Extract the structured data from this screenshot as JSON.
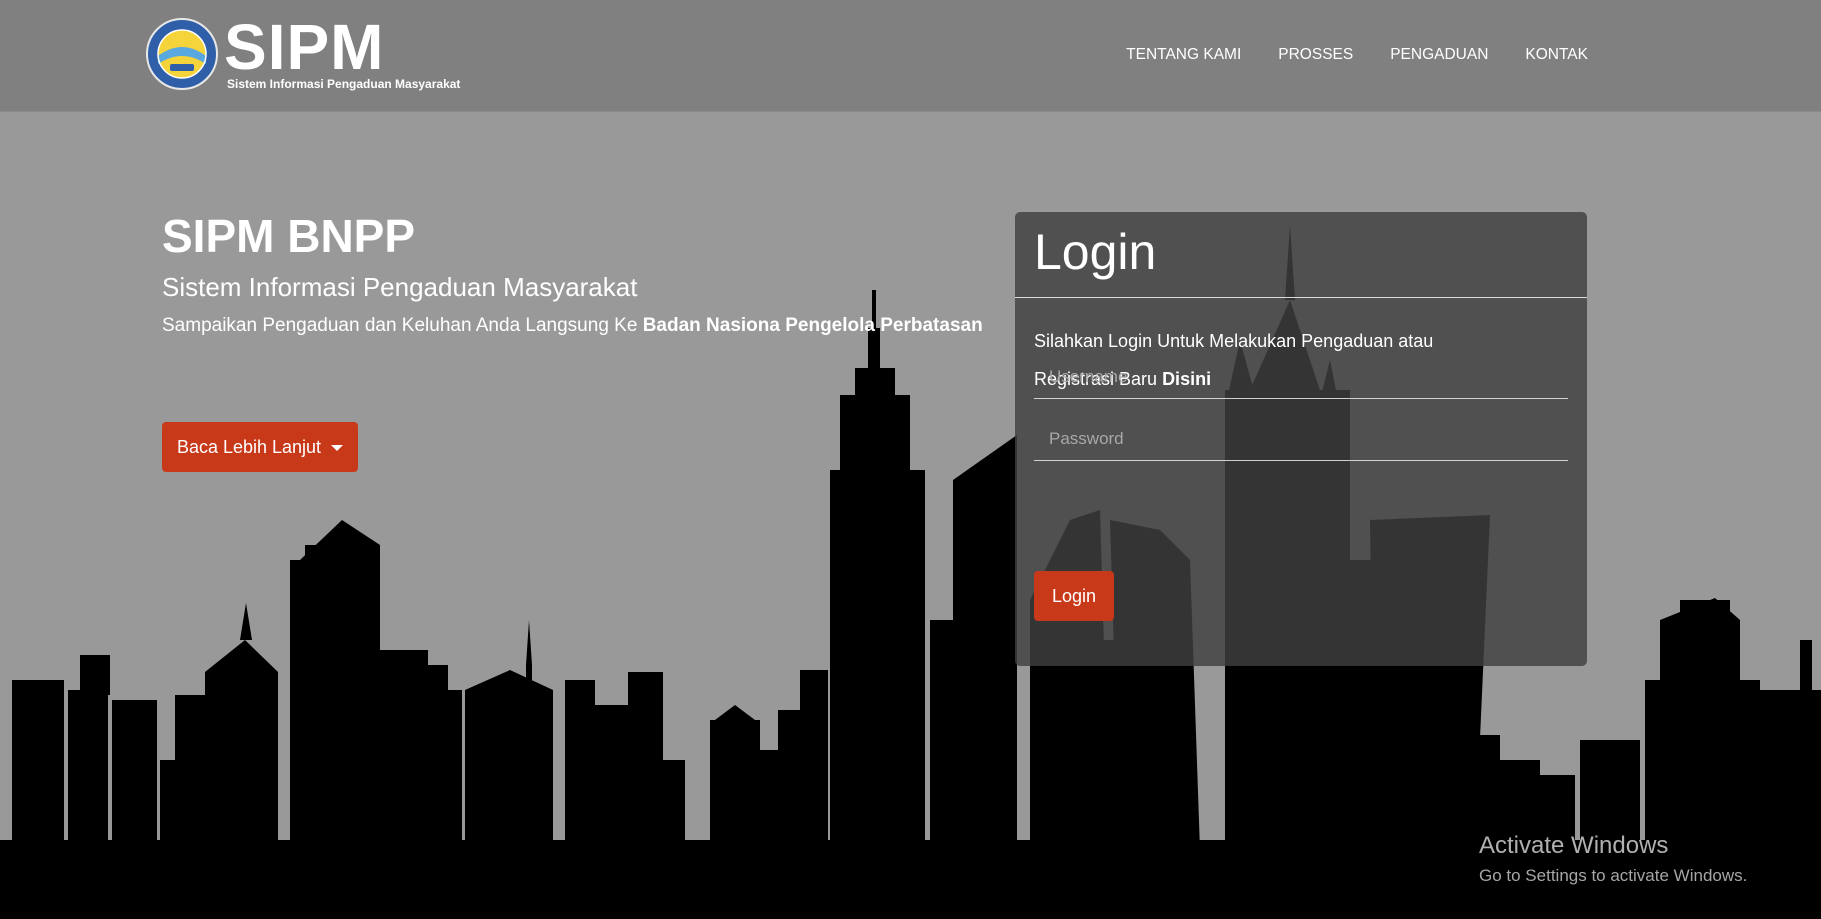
{
  "header": {
    "brand_name": "SIPM",
    "brand_tagline": "Sistem Informasi Pengaduan Masyarakat",
    "nav": [
      "TENTANG KAMI",
      "PROSSES",
      "PENGADUAN",
      "KONTAK"
    ]
  },
  "hero": {
    "title": "SIPM BNPP",
    "subtitle": "Sistem Informasi Pengaduan Masyarakat",
    "text": "Sampaikan Pengaduan dan Keluhan Anda Langsung Ke",
    "text_bold": "Badan Nasiona Pengelola Perbatasan",
    "read_more_label": "Baca Lebih Lanjut"
  },
  "login": {
    "title": "Login",
    "info_line1": "Silahkan Login Untuk Melakukan Pengaduan atau",
    "info_line2": "Registrasi Baru",
    "register_link": "Disini",
    "username_placeholder": "Username",
    "password_placeholder": "Password",
    "button_label": "Login"
  },
  "watermark": {
    "title": "Activate Windows",
    "subtitle": "Go to Settings to activate Windows."
  },
  "colors": {
    "navbar": "#808080",
    "background": "#999999",
    "accent": "#c8391a",
    "card": "#404040",
    "skyline": "#000000"
  }
}
